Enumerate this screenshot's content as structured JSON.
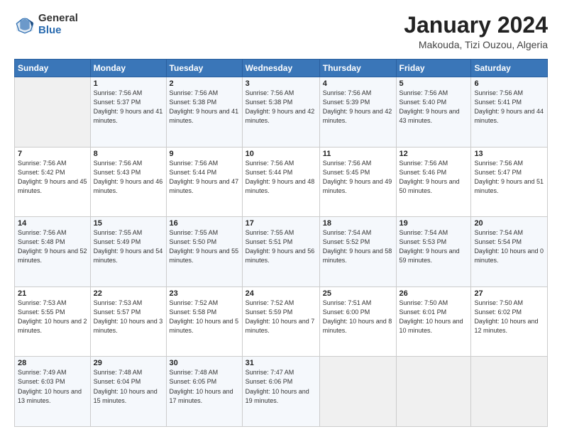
{
  "logo": {
    "general": "General",
    "blue": "Blue"
  },
  "header": {
    "month": "January 2024",
    "location": "Makouda, Tizi Ouzou, Algeria"
  },
  "weekdays": [
    "Sunday",
    "Monday",
    "Tuesday",
    "Wednesday",
    "Thursday",
    "Friday",
    "Saturday"
  ],
  "weeks": [
    [
      {
        "day": "",
        "sunrise": "",
        "sunset": "",
        "daylight": ""
      },
      {
        "day": "1",
        "sunrise": "Sunrise: 7:56 AM",
        "sunset": "Sunset: 5:37 PM",
        "daylight": "Daylight: 9 hours and 41 minutes."
      },
      {
        "day": "2",
        "sunrise": "Sunrise: 7:56 AM",
        "sunset": "Sunset: 5:38 PM",
        "daylight": "Daylight: 9 hours and 41 minutes."
      },
      {
        "day": "3",
        "sunrise": "Sunrise: 7:56 AM",
        "sunset": "Sunset: 5:38 PM",
        "daylight": "Daylight: 9 hours and 42 minutes."
      },
      {
        "day": "4",
        "sunrise": "Sunrise: 7:56 AM",
        "sunset": "Sunset: 5:39 PM",
        "daylight": "Daylight: 9 hours and 42 minutes."
      },
      {
        "day": "5",
        "sunrise": "Sunrise: 7:56 AM",
        "sunset": "Sunset: 5:40 PM",
        "daylight": "Daylight: 9 hours and 43 minutes."
      },
      {
        "day": "6",
        "sunrise": "Sunrise: 7:56 AM",
        "sunset": "Sunset: 5:41 PM",
        "daylight": "Daylight: 9 hours and 44 minutes."
      }
    ],
    [
      {
        "day": "7",
        "sunrise": "Sunrise: 7:56 AM",
        "sunset": "Sunset: 5:42 PM",
        "daylight": "Daylight: 9 hours and 45 minutes."
      },
      {
        "day": "8",
        "sunrise": "Sunrise: 7:56 AM",
        "sunset": "Sunset: 5:43 PM",
        "daylight": "Daylight: 9 hours and 46 minutes."
      },
      {
        "day": "9",
        "sunrise": "Sunrise: 7:56 AM",
        "sunset": "Sunset: 5:44 PM",
        "daylight": "Daylight: 9 hours and 47 minutes."
      },
      {
        "day": "10",
        "sunrise": "Sunrise: 7:56 AM",
        "sunset": "Sunset: 5:44 PM",
        "daylight": "Daylight: 9 hours and 48 minutes."
      },
      {
        "day": "11",
        "sunrise": "Sunrise: 7:56 AM",
        "sunset": "Sunset: 5:45 PM",
        "daylight": "Daylight: 9 hours and 49 minutes."
      },
      {
        "day": "12",
        "sunrise": "Sunrise: 7:56 AM",
        "sunset": "Sunset: 5:46 PM",
        "daylight": "Daylight: 9 hours and 50 minutes."
      },
      {
        "day": "13",
        "sunrise": "Sunrise: 7:56 AM",
        "sunset": "Sunset: 5:47 PM",
        "daylight": "Daylight: 9 hours and 51 minutes."
      }
    ],
    [
      {
        "day": "14",
        "sunrise": "Sunrise: 7:56 AM",
        "sunset": "Sunset: 5:48 PM",
        "daylight": "Daylight: 9 hours and 52 minutes."
      },
      {
        "day": "15",
        "sunrise": "Sunrise: 7:55 AM",
        "sunset": "Sunset: 5:49 PM",
        "daylight": "Daylight: 9 hours and 54 minutes."
      },
      {
        "day": "16",
        "sunrise": "Sunrise: 7:55 AM",
        "sunset": "Sunset: 5:50 PM",
        "daylight": "Daylight: 9 hours and 55 minutes."
      },
      {
        "day": "17",
        "sunrise": "Sunrise: 7:55 AM",
        "sunset": "Sunset: 5:51 PM",
        "daylight": "Daylight: 9 hours and 56 minutes."
      },
      {
        "day": "18",
        "sunrise": "Sunrise: 7:54 AM",
        "sunset": "Sunset: 5:52 PM",
        "daylight": "Daylight: 9 hours and 58 minutes."
      },
      {
        "day": "19",
        "sunrise": "Sunrise: 7:54 AM",
        "sunset": "Sunset: 5:53 PM",
        "daylight": "Daylight: 9 hours and 59 minutes."
      },
      {
        "day": "20",
        "sunrise": "Sunrise: 7:54 AM",
        "sunset": "Sunset: 5:54 PM",
        "daylight": "Daylight: 10 hours and 0 minutes."
      }
    ],
    [
      {
        "day": "21",
        "sunrise": "Sunrise: 7:53 AM",
        "sunset": "Sunset: 5:55 PM",
        "daylight": "Daylight: 10 hours and 2 minutes."
      },
      {
        "day": "22",
        "sunrise": "Sunrise: 7:53 AM",
        "sunset": "Sunset: 5:57 PM",
        "daylight": "Daylight: 10 hours and 3 minutes."
      },
      {
        "day": "23",
        "sunrise": "Sunrise: 7:52 AM",
        "sunset": "Sunset: 5:58 PM",
        "daylight": "Daylight: 10 hours and 5 minutes."
      },
      {
        "day": "24",
        "sunrise": "Sunrise: 7:52 AM",
        "sunset": "Sunset: 5:59 PM",
        "daylight": "Daylight: 10 hours and 7 minutes."
      },
      {
        "day": "25",
        "sunrise": "Sunrise: 7:51 AM",
        "sunset": "Sunset: 6:00 PM",
        "daylight": "Daylight: 10 hours and 8 minutes."
      },
      {
        "day": "26",
        "sunrise": "Sunrise: 7:50 AM",
        "sunset": "Sunset: 6:01 PM",
        "daylight": "Daylight: 10 hours and 10 minutes."
      },
      {
        "day": "27",
        "sunrise": "Sunrise: 7:50 AM",
        "sunset": "Sunset: 6:02 PM",
        "daylight": "Daylight: 10 hours and 12 minutes."
      }
    ],
    [
      {
        "day": "28",
        "sunrise": "Sunrise: 7:49 AM",
        "sunset": "Sunset: 6:03 PM",
        "daylight": "Daylight: 10 hours and 13 minutes."
      },
      {
        "day": "29",
        "sunrise": "Sunrise: 7:48 AM",
        "sunset": "Sunset: 6:04 PM",
        "daylight": "Daylight: 10 hours and 15 minutes."
      },
      {
        "day": "30",
        "sunrise": "Sunrise: 7:48 AM",
        "sunset": "Sunset: 6:05 PM",
        "daylight": "Daylight: 10 hours and 17 minutes."
      },
      {
        "day": "31",
        "sunrise": "Sunrise: 7:47 AM",
        "sunset": "Sunset: 6:06 PM",
        "daylight": "Daylight: 10 hours and 19 minutes."
      },
      {
        "day": "",
        "sunrise": "",
        "sunset": "",
        "daylight": ""
      },
      {
        "day": "",
        "sunrise": "",
        "sunset": "",
        "daylight": ""
      },
      {
        "day": "",
        "sunrise": "",
        "sunset": "",
        "daylight": ""
      }
    ]
  ]
}
